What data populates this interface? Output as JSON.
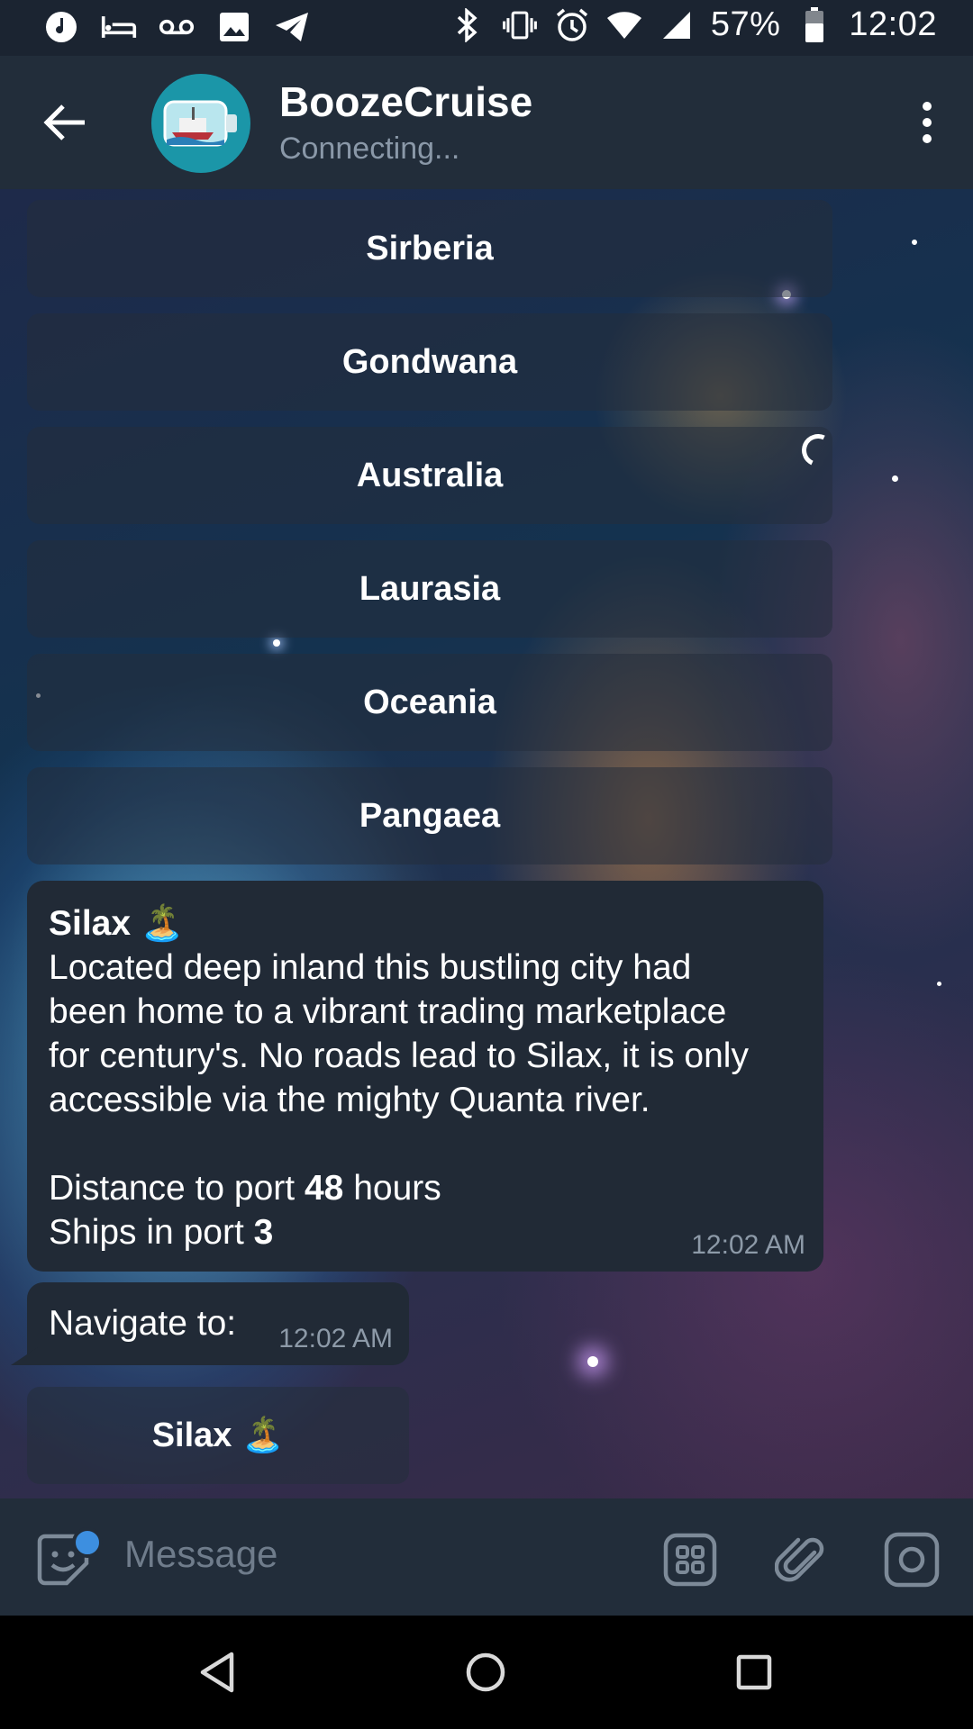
{
  "status_bar": {
    "battery": "57%",
    "time": "12:02",
    "left_icons": [
      "music-note-icon",
      "bed-icon",
      "voicemail-icon",
      "image-icon",
      "telegram-icon"
    ],
    "right_icons": [
      "bluetooth-icon",
      "vibrate-icon",
      "alarm-icon",
      "wifi-icon",
      "signal-icon",
      "battery-icon"
    ]
  },
  "header": {
    "title": "BoozeCruise",
    "subtitle": "Connecting..."
  },
  "keyboard_buttons": [
    {
      "label": "Sirberia"
    },
    {
      "label": "Gondwana"
    },
    {
      "label": "Australia"
    },
    {
      "label": "Laurasia"
    },
    {
      "label": "Oceania"
    },
    {
      "label": "Pangaea"
    }
  ],
  "message": {
    "title": "Silax 🏝️",
    "lines": [
      "Located deep inland this bustling city had",
      "been home to a vibrant trading marketplace",
      "for century's. No roads lead to Silax, it is only",
      "accessible via the mighty Quanta river."
    ],
    "distance_prefix": "Distance to port ",
    "distance_value": "48",
    "distance_suffix": " hours",
    "ships_prefix": "Ships in port ",
    "ships_value": "3",
    "time": "12:02 AM"
  },
  "navigate": {
    "text": "Navigate to:",
    "time": "12:02 AM",
    "button_label": "Silax 🏝️"
  },
  "input": {
    "placeholder": "Message"
  },
  "colors": {
    "header_bg": "#222d3a",
    "bubble_bg": "#212a36",
    "accent": "#3d8fe0",
    "avatar_bg": "#1b96a8"
  }
}
